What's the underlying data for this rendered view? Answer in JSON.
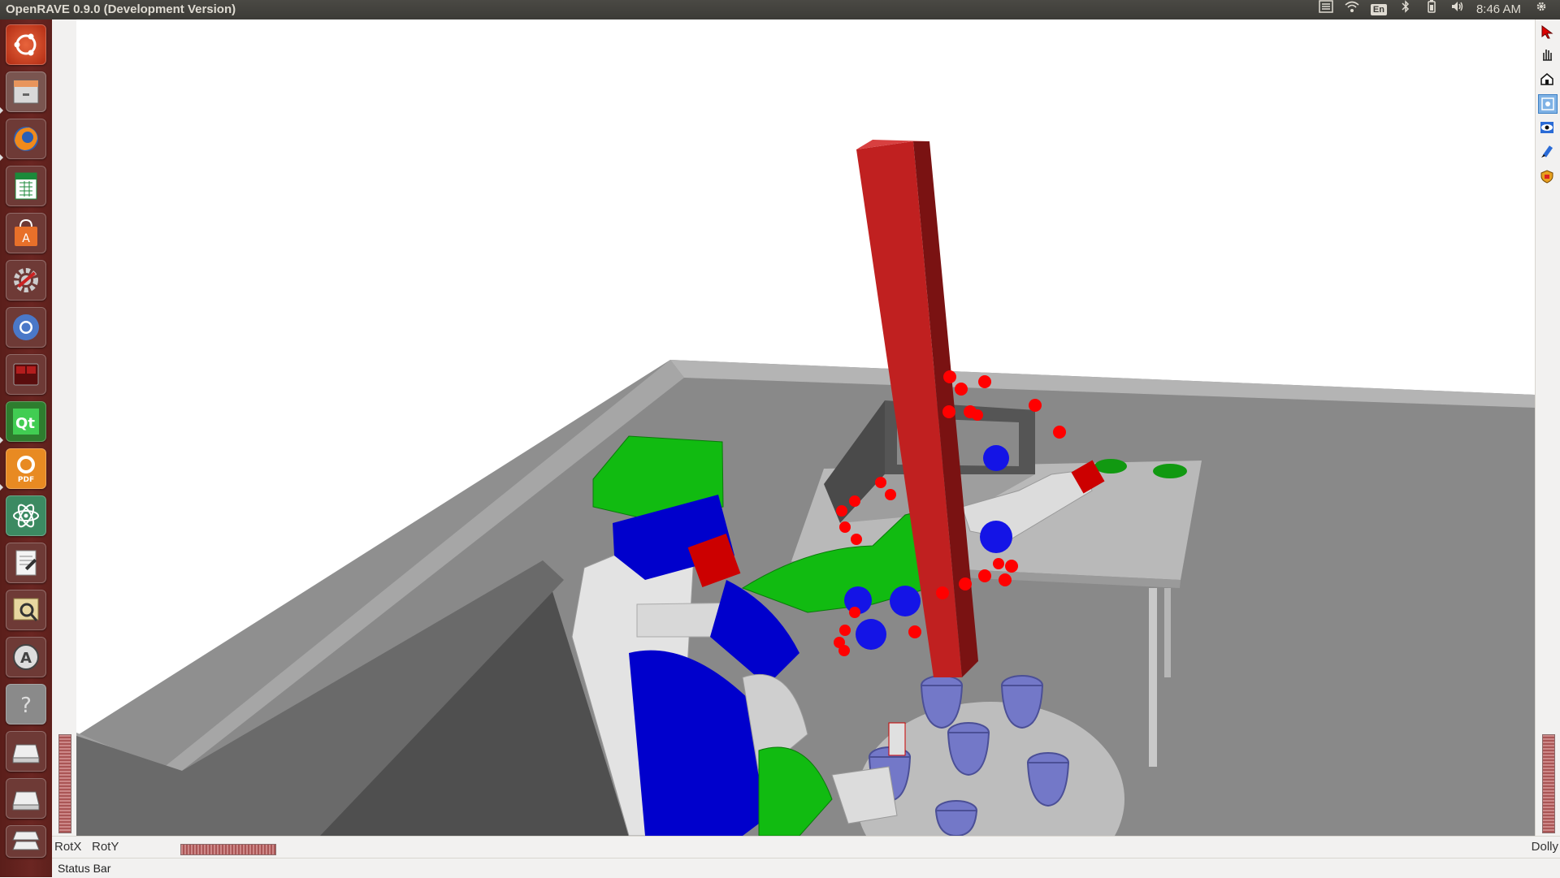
{
  "window": {
    "title": "OpenRAVE 0.9.0 (Development Version)"
  },
  "panel": {
    "keyboard_layout": "En",
    "clock": "8:46 AM"
  },
  "launcher": {
    "items": [
      {
        "name": "dash-home"
      },
      {
        "name": "files"
      },
      {
        "name": "firefox"
      },
      {
        "name": "libreoffice-calc"
      },
      {
        "name": "software-center"
      },
      {
        "name": "system-settings"
      },
      {
        "name": "chromium"
      },
      {
        "name": "terminal"
      },
      {
        "name": "qt-creator"
      },
      {
        "name": "foxit-pdf"
      },
      {
        "name": "atom"
      },
      {
        "name": "text-editor"
      },
      {
        "name": "image-viewer"
      },
      {
        "name": "software-updater"
      },
      {
        "name": "help"
      },
      {
        "name": "drive-1"
      },
      {
        "name": "drive-2"
      },
      {
        "name": "workspaces"
      }
    ]
  },
  "toolbar": {
    "tools": [
      "select-pointer",
      "pan-hand",
      "home-view",
      "view-all",
      "camera-view",
      "collision-tool",
      "physics-tool"
    ]
  },
  "wheels": {
    "rotx_label": "RotX",
    "roty_label": "RotY",
    "dolly_label": "Dolly"
  },
  "status": {
    "text": "Status Bar"
  },
  "colors": {
    "robot_blue": "#0000cc",
    "robot_green": "#11bb11",
    "pillar_red": "#c02020",
    "marker_red": "#ff0000",
    "cup_purple": "#7b7fd0",
    "floor_gray": "#8c8c8c"
  }
}
